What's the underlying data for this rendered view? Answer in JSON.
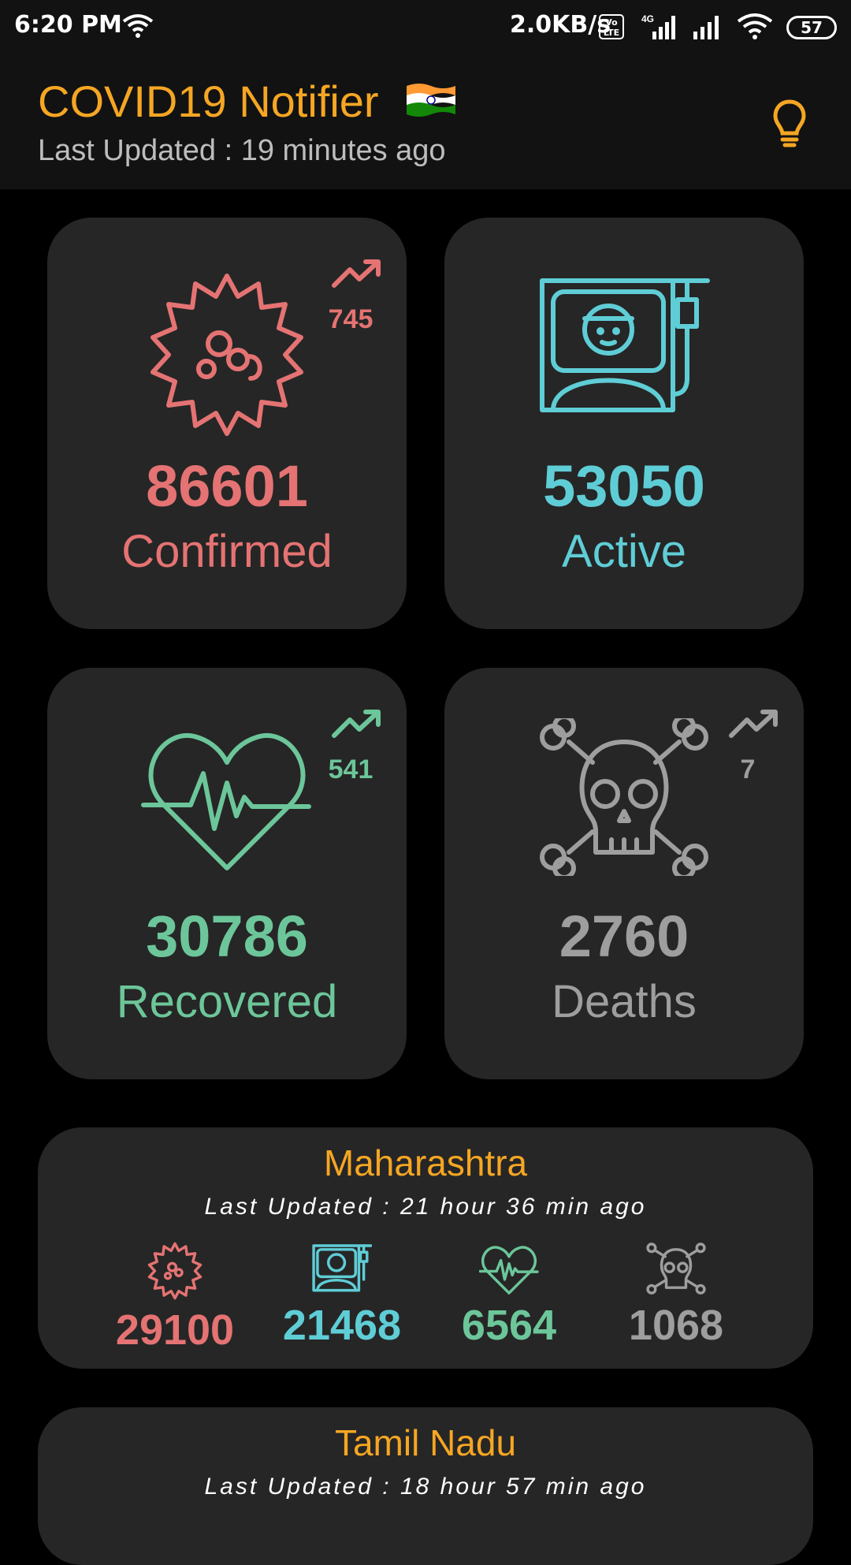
{
  "status_bar": {
    "time": "6:20 PM",
    "speed": "2.0KB/s",
    "volte": "Vo LTE",
    "battery": "57"
  },
  "header": {
    "title": "COVID19 Notifier",
    "subtitle": "Last Updated : 19 minutes ago"
  },
  "colors": {
    "confirmed": "#e57373",
    "active": "#5fcdd6",
    "recovered": "#6cc69a",
    "deaths": "#9e9e9e",
    "accent": "#f5a623"
  },
  "cards": {
    "confirmed": {
      "value": "86601",
      "label": "Confirmed",
      "delta": "745"
    },
    "active": {
      "value": "53050",
      "label": "Active"
    },
    "recovered": {
      "value": "30786",
      "label": "Recovered",
      "delta": "541"
    },
    "deaths": {
      "value": "2760",
      "label": "Deaths",
      "delta": "7"
    }
  },
  "states": [
    {
      "name": "Maharashtra",
      "updated": "Last Updated : 21 hour 36 min ago",
      "confirmed": "29100",
      "active": "21468",
      "recovered": "6564",
      "deaths": "1068"
    },
    {
      "name": "Tamil Nadu",
      "updated": "Last Updated : 18 hour 57 min ago"
    }
  ]
}
